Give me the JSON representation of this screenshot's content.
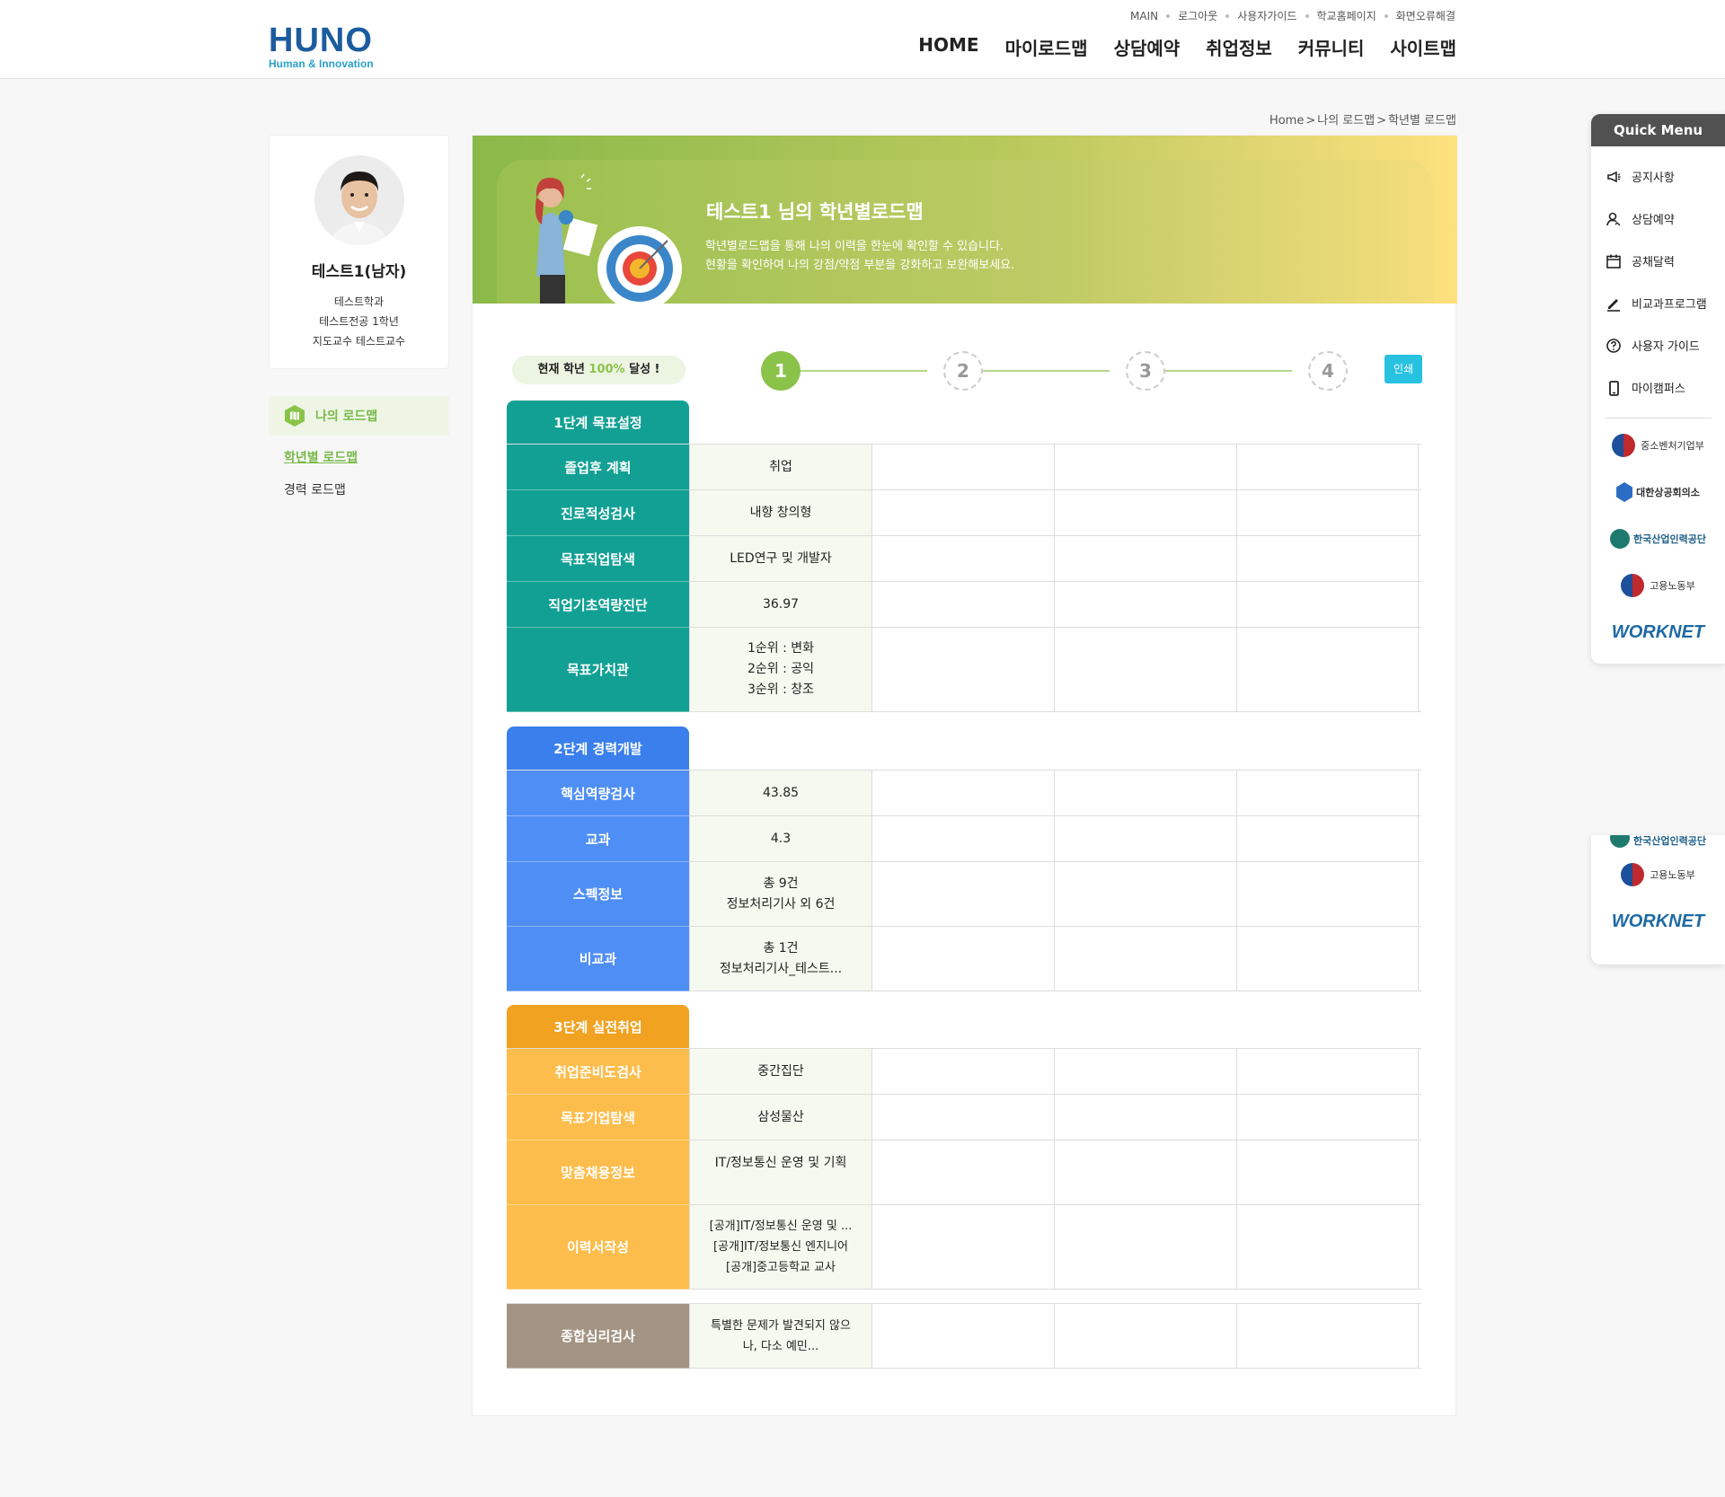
{
  "header": {
    "logo_main": "HUNO",
    "logo_sub": "Human & Innovation",
    "util_links": [
      "MAIN",
      "로그아웃",
      "사용자가이드",
      "학교홈페이지",
      "화면오류해결"
    ],
    "gnb": [
      "HOME",
      "마이로드맵",
      "상담예약",
      "취업정보",
      "커뮤니티",
      "사이트맵"
    ]
  },
  "breadcrumb": [
    "Home",
    "나의 로드맵",
    "학년별 로드맵"
  ],
  "profile": {
    "name": "테스트1(남자)",
    "dept": "테스트학과",
    "major": "테스트전공 1학년",
    "advisor": "지도교수 테스트교수"
  },
  "lnb": {
    "title": "나의 로드맵",
    "items": [
      "학년별 로드맵",
      "경력 로드맵"
    ]
  },
  "banner": {
    "title": "테스트1 님의 학년별로드맵",
    "desc1": "학년별로드맵을 통해 나의 이력을 한눈에 확인할 수 있습니다.",
    "desc2": "현황을 확인하여 나의 강점/약점 부분을 강화하고 보완해보세요."
  },
  "progress": {
    "label_prefix": "현재 학년",
    "percent": "100%",
    "label_suffix": "달성 !",
    "steps": [
      "1",
      "2",
      "3",
      "4"
    ],
    "current_step": 1,
    "print": "인쇄"
  },
  "stages": [
    {
      "title": "1단계 목표설정",
      "rows": [
        {
          "label": "졸업후 계획",
          "value": [
            "취업"
          ]
        },
        {
          "label": "진로적성검사",
          "value": [
            "내향 창의형"
          ]
        },
        {
          "label": "목표직업탐색",
          "value": [
            "LED연구 및 개발자"
          ]
        },
        {
          "label": "직업기초역량진단",
          "value": [
            "36.97"
          ]
        },
        {
          "label": "목표가치관",
          "value": [
            "1순위 : 변화",
            "2순위 : 공익",
            "3순위 : 창조"
          ]
        }
      ]
    },
    {
      "title": "2단계 경력개발",
      "rows": [
        {
          "label": "핵심역량검사",
          "value": [
            "43.85"
          ]
        },
        {
          "label": "교과",
          "value": [
            "4.3"
          ]
        },
        {
          "label": "스펙정보",
          "value": [
            "총 9건",
            "정보처리기사 외 6건"
          ]
        },
        {
          "label": "비교과",
          "value": [
            "총 1건",
            "정보처리기사_테스트..."
          ]
        }
      ]
    },
    {
      "title": "3단계 실전취업",
      "rows": [
        {
          "label": "취업준비도검사",
          "value": [
            "중간집단"
          ]
        },
        {
          "label": "목표기업탐색",
          "value": [
            "삼성물산"
          ]
        },
        {
          "label": "맞춤채용정보",
          "value": [
            "IT/정보통신 운영 및 기획"
          ]
        },
        {
          "label": "이력서작성",
          "value": [
            "[공개]IT/정보통신 운영 및 ...",
            "[공개]IT/정보통신 엔지니어",
            "[공개]중고등학교 교사"
          ]
        }
      ]
    },
    {
      "title": "",
      "rows": [
        {
          "label": "종합심리검사",
          "value": [
            "특별한 문제가 발견되지 않으",
            "나, 다소 예민..."
          ]
        }
      ]
    }
  ],
  "quick_menu": {
    "title": "Quick Menu",
    "items": [
      "공지사항",
      "상담예약",
      "공채달력",
      "비교과프로그램",
      "사용자 가이드",
      "마이캠퍼스"
    ],
    "partners": [
      "중소벤처기업부",
      "대한상공회의소",
      "한국산업인력공단",
      "고용노동부",
      "WORKNET"
    ],
    "partners_dup": [
      "한국산업인력공단",
      "고용노동부",
      "WORKNET"
    ]
  },
  "colors": {
    "stage1": "#12a094",
    "stage2": "#4f8ef5",
    "stage3": "#fdbd4c",
    "stage4": "#a39382",
    "accent": "#8bc34a",
    "print": "#27c2e0"
  }
}
